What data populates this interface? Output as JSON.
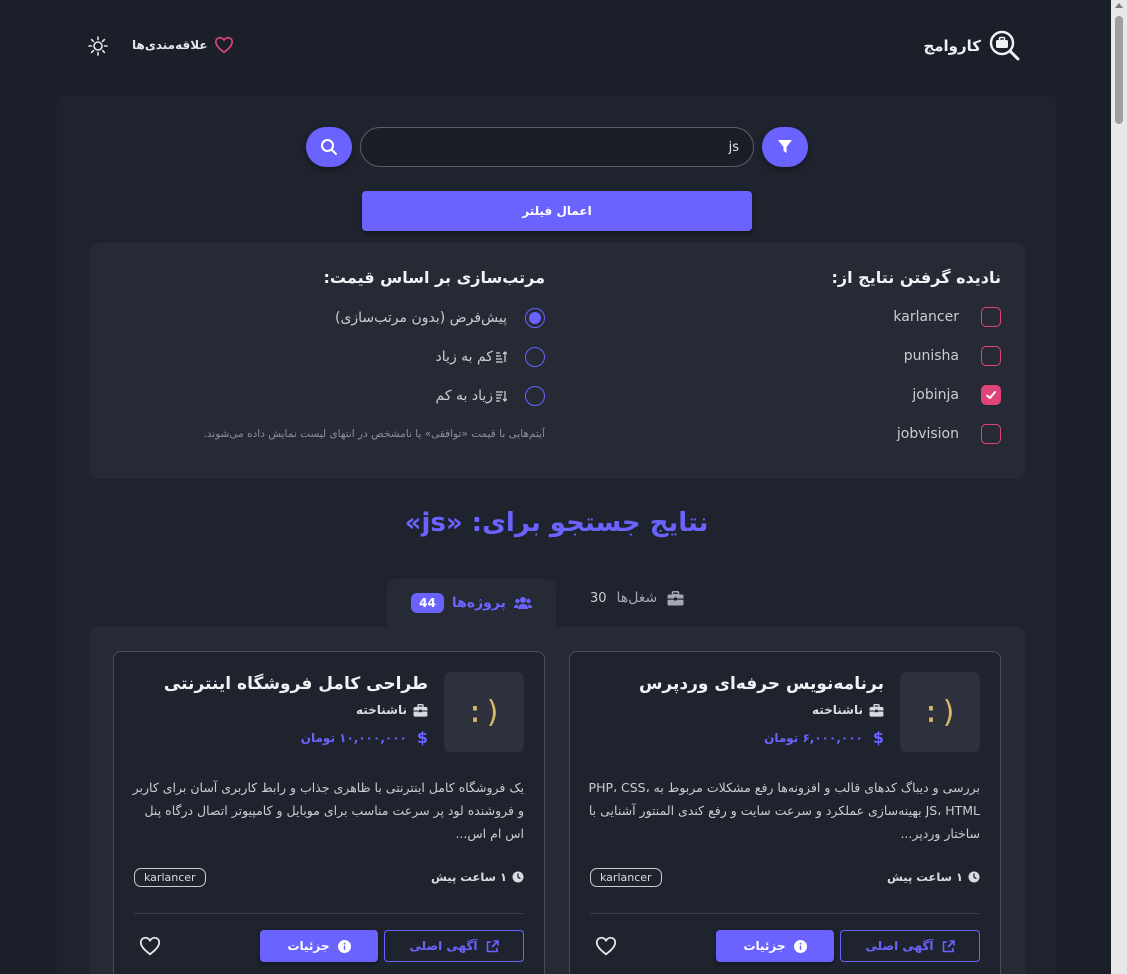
{
  "header": {
    "brand": "کاروامج",
    "favorites_label": "علاقه‌مندی‌ها"
  },
  "search": {
    "value": "js",
    "placeholder": "",
    "apply_label": "اعمال فیلتر"
  },
  "ignore_sources": {
    "title": "نادیده گرفتن نتایج از:",
    "items": [
      {
        "label": "karlancer",
        "checked": false
      },
      {
        "label": "punisha",
        "checked": false
      },
      {
        "label": "jobinja",
        "checked": true
      },
      {
        "label": "jobvision",
        "checked": false
      }
    ]
  },
  "sort": {
    "title": "مرتب‌سازی بر اساس قیمت:",
    "options": [
      {
        "label": "پیش‌فرض (بدون مرتب‌سازی)",
        "selected": true
      },
      {
        "label": "کم به زیاد",
        "selected": false
      },
      {
        "label": "زیاد به کم",
        "selected": false
      }
    ],
    "note": "آیتم‌هایی با قیمت «توافقی» یا نامشخص در انتهای لیست نمایش داده می‌شوند."
  },
  "results": {
    "title": "نتایج جستجو برای: «js»"
  },
  "tabs": {
    "projects": {
      "label": "پروژه‌ها",
      "count": "44"
    },
    "jobs": {
      "label": "شغل‌ها",
      "count": "30"
    }
  },
  "cards": [
    {
      "title": "برنامه‌نویس حرفه‌ای وردپرس",
      "company": "ناشناخته",
      "price": "۶,۰۰۰,۰۰۰ تومان",
      "thumb": ":)",
      "description": "بررسی و دیباگ کدهای قالب و افزونه‌ها رفع مشکلات مربوط به PHP، CSS، JS، HTML بهینه‌سازی عملکرد و سرعت سایت و رفع کندی المنتور آشنایی با ساختار وردپر...",
      "time": "۱ ساعت پیش",
      "tag": "karlancer",
      "original_label": "آگهی اصلی",
      "details_label": "جزئیات"
    },
    {
      "title": "طراحی کامل فروشگاه اینترنتی",
      "company": "ناشناخته",
      "price": "۱۰,۰۰۰,۰۰۰ تومان",
      "thumb": ":)",
      "description": "یک فروشگاه کامل اینترنتی با ظاهری جذاب و رابط کاربری آسان برای کاربر و فروشنده لود پر سرعت مناسب برای موبایل و کامپیوتر اتصال درگاه پنل اس ام اس...",
      "time": "۱ ساعت پیش",
      "tag": "karlancer",
      "original_label": "آگهی اصلی",
      "details_label": "جزئیات"
    }
  ],
  "colors": {
    "accent": "#6b63ff",
    "checkbox": "#e0447a",
    "background": "#1b1f29",
    "panel": "#1f232e",
    "surface": "#252a35"
  },
  "icons": {
    "logo": "briefcase-search-icon",
    "favorites": "heart-icon",
    "theme": "sun-icon",
    "filter": "funnel-icon",
    "search": "search-icon",
    "projects": "users-icon",
    "jobs": "briefcase-icon",
    "time": "clock-icon",
    "price": "dollar-icon",
    "details": "info-icon",
    "original": "external-link-icon"
  }
}
